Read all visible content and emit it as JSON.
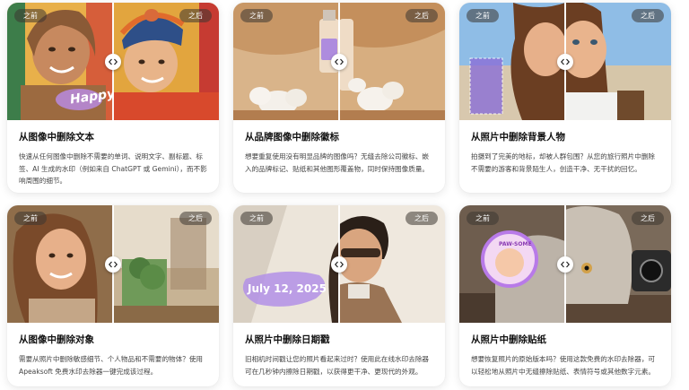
{
  "labels": {
    "before": "之前",
    "after": "之后"
  },
  "cards": [
    {
      "title": "从图像中删除文本",
      "desc": "快速从任何图像中删除不需要的单词、说明文字、副标题、标签、AI 生成的水印（例如来自 ChatGPT 或 Gemini），而不影响周围的细节。",
      "overlay_text": "Happy"
    },
    {
      "title": "从品牌图像中删除徽标",
      "desc": "想要重复使用没有明显品牌的图像吗？无缝去除公司徽标、嵌入的品牌标记、贴纸和其他图形覆盖物，同时保持图像质量。"
    },
    {
      "title": "从照片中删除背景人物",
      "desc": "拍摄到了完美的地标，却被人群包围？从您的旅行照片中删除不需要的游客和背景陌生人，创造干净、无干扰的回忆。"
    },
    {
      "title": "从图像中删除对象",
      "desc": "需要从照片中删除敏感细节、个人物品和不需要的物体？使用 Apeaksoft 免费水印去除器一键完成该过程。"
    },
    {
      "title": "从照片中删除日期戳",
      "desc": "旧相机时间戳让您的照片看起来过时？使用此在线水印去除器可在几秒钟内擦除日期戳，以获得更干净、更现代的外观。",
      "overlay_text": "July 12, 2025"
    },
    {
      "title": "从照片中删除贴纸",
      "desc": "想要恢复照片的原始版本吗？使用这款免费的水印去除器，可以轻松地从照片中无缝擦除贴纸、表情符号或其他数字元素。",
      "overlay_text": "PAW-SOME"
    }
  ],
  "icons": {
    "handle": "compare-arrows-icon"
  }
}
